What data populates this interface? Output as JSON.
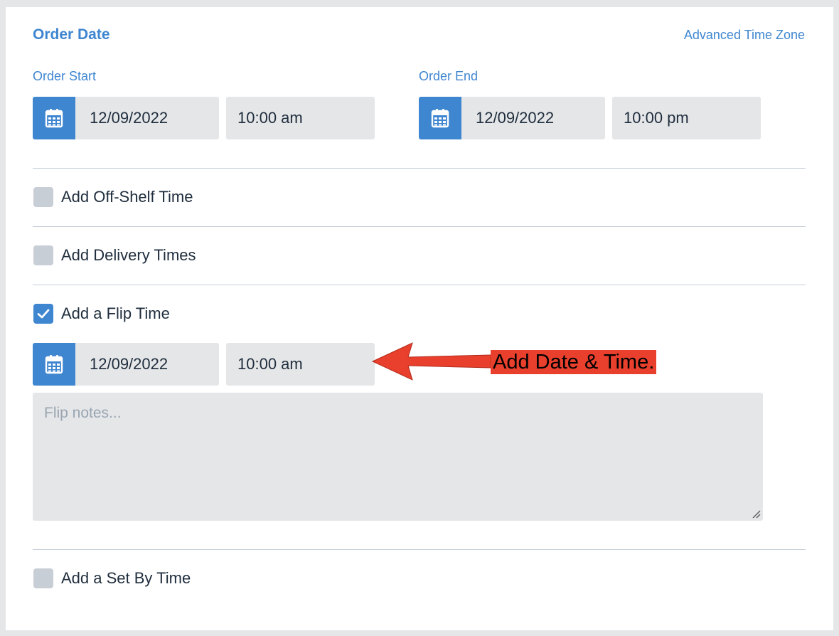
{
  "order_date": {
    "title": "Order Date",
    "advanced_link": "Advanced Time Zone",
    "start": {
      "label": "Order Start",
      "date": "12/09/2022",
      "time": "10:00 am"
    },
    "end": {
      "label": "Order End",
      "date": "12/09/2022",
      "time": "10:00 pm"
    }
  },
  "options": {
    "off_shelf": {
      "label": "Add Off-Shelf Time",
      "checked": false
    },
    "delivery": {
      "label": "Add Delivery Times",
      "checked": false
    },
    "flip": {
      "label": "Add a Flip Time",
      "checked": true,
      "date": "12/09/2022",
      "time": "10:00 am",
      "notes_placeholder": "Flip notes...",
      "notes_value": ""
    },
    "set_by": {
      "label": "Add a Set By Time",
      "checked": false
    }
  },
  "annotation": {
    "text": "Add Date & Time.",
    "color": "#e8402d"
  },
  "colors": {
    "accent": "#3f86d0",
    "field_bg": "#e5e6e8",
    "checkbox_unchecked": "#c8ced6",
    "text": "#1f2d3d"
  }
}
